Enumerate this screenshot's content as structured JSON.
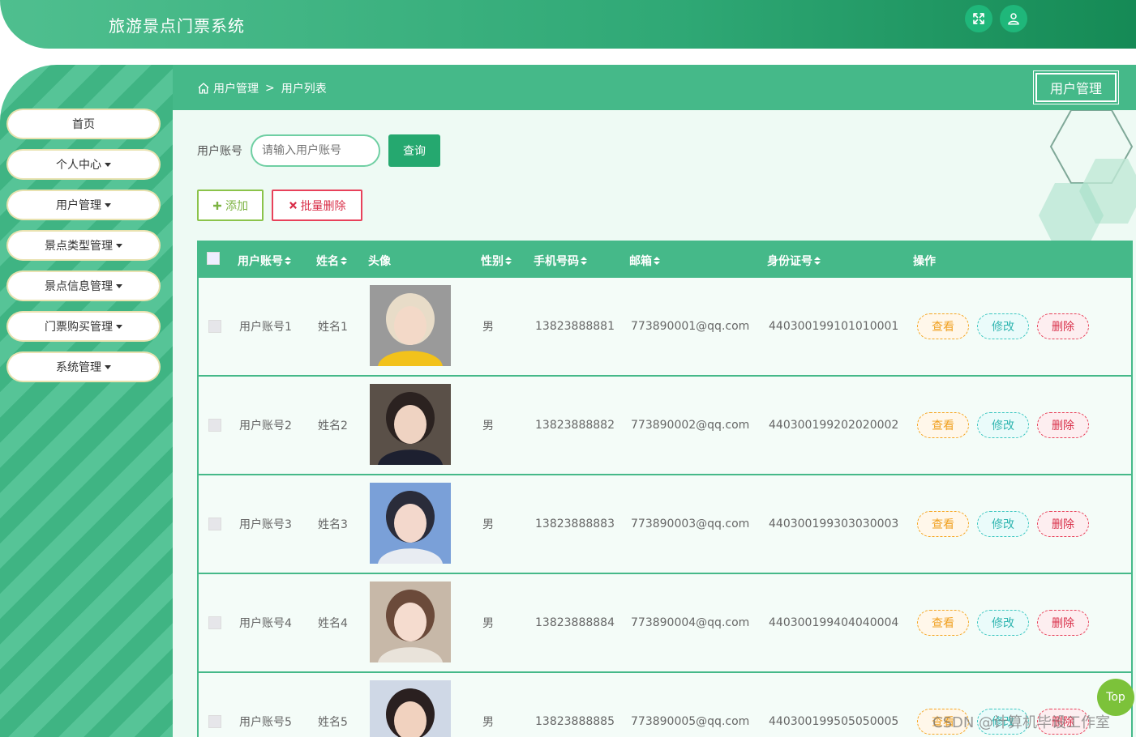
{
  "header": {
    "title": "旅游景点门票系统"
  },
  "sidebar": {
    "items": [
      {
        "label": "首页",
        "has_caret": false
      },
      {
        "label": "个人中心",
        "has_caret": true
      },
      {
        "label": "用户管理",
        "has_caret": true
      },
      {
        "label": "景点类型管理",
        "has_caret": true
      },
      {
        "label": "景点信息管理",
        "has_caret": true
      },
      {
        "label": "门票购买管理",
        "has_caret": true
      },
      {
        "label": "系统管理",
        "has_caret": true
      }
    ]
  },
  "breadcrumb": {
    "parent": "用户管理",
    "separator": ">",
    "current": "用户列表"
  },
  "page_tag": "用户管理",
  "search": {
    "label": "用户账号",
    "placeholder": "请输入用户账号",
    "button": "查询"
  },
  "actions": {
    "add": "添加",
    "batch_delete": "批量删除"
  },
  "table": {
    "columns": [
      "用户账号",
      "姓名",
      "头像",
      "性别",
      "手机号码",
      "邮箱",
      "身份证号",
      "操作"
    ],
    "rows": [
      {
        "account": "用户账号1",
        "name": "姓名1",
        "gender": "男",
        "phone": "13823888881",
        "email": "773890001@qq.com",
        "id_card": "440300199101010001"
      },
      {
        "account": "用户账号2",
        "name": "姓名2",
        "gender": "男",
        "phone": "13823888882",
        "email": "773890002@qq.com",
        "id_card": "440300199202020002"
      },
      {
        "account": "用户账号3",
        "name": "姓名3",
        "gender": "男",
        "phone": "13823888883",
        "email": "773890003@qq.com",
        "id_card": "440300199303030003"
      },
      {
        "account": "用户账号4",
        "name": "姓名4",
        "gender": "男",
        "phone": "13823888884",
        "email": "773890004@qq.com",
        "id_card": "440300199404040004"
      },
      {
        "account": "用户账号5",
        "name": "姓名5",
        "gender": "男",
        "phone": "13823888885",
        "email": "773890005@qq.com",
        "id_card": "440300199505050005"
      }
    ],
    "row_actions": {
      "view": "查看",
      "edit": "修改",
      "delete": "删除"
    }
  },
  "top_button": "Top",
  "watermark": "CSDN @计算机毕设工作室",
  "colors": {
    "primary": "#45b989",
    "header_end": "#158a55",
    "add": "#8bc34a",
    "danger": "#e8415a",
    "view": "#f5a623",
    "edit": "#3cc7c1"
  }
}
